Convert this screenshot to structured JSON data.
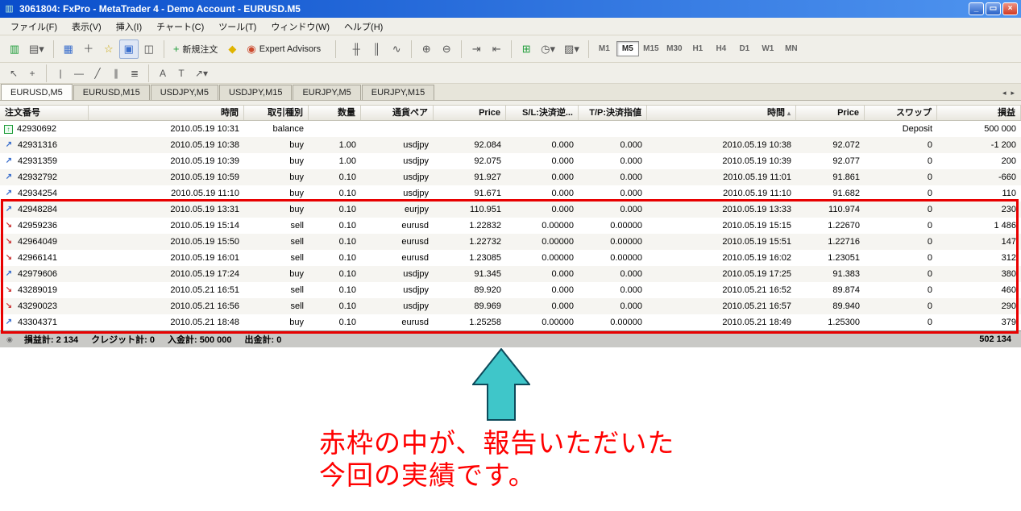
{
  "window": {
    "title": "3061804: FxPro - MetaTrader 4 - Demo Account - EURUSD.M5",
    "icon_glyph": "▥",
    "controls": {
      "minimize": "_",
      "restore": "▭",
      "close": "×"
    }
  },
  "menu": {
    "items": [
      "ファイル(F)",
      "表示(V)",
      "挿入(I)",
      "チャート(C)",
      "ツール(T)",
      "ウィンドウ(W)",
      "ヘルプ(H)"
    ]
  },
  "toolbar_main": {
    "buttons": [
      {
        "name": "new-chart-button",
        "glyph": "▥",
        "color": "#1f9d3a"
      },
      {
        "name": "profiles-button",
        "glyph": "▤▾"
      },
      {
        "separator": true
      },
      {
        "name": "market-watch-button",
        "glyph": "▦",
        "color": "#3a6ecc"
      },
      {
        "name": "data-window-button",
        "glyph": "＋"
      },
      {
        "name": "navigator-button",
        "glyph": "☆",
        "color": "#c8a400"
      },
      {
        "name": "terminal-button",
        "glyph": "▣",
        "color": "#3a6ecc",
        "pressed": true
      },
      {
        "name": "strategy-tester-button",
        "glyph": "◫"
      },
      {
        "separator": true
      },
      {
        "name": "new-order-button",
        "glyph": "+",
        "color": "#1f9d3a",
        "label": "新規注文"
      },
      {
        "name": "metaeditor-button",
        "glyph": "◆",
        "color": "#e0b400"
      },
      {
        "name": "expert-advisors-button",
        "glyph": "◉",
        "color": "#cc4a2e",
        "label": "Expert Advisors"
      },
      {
        "separator": true,
        "wide": true
      },
      {
        "name": "bar-chart-button",
        "glyph": "╫"
      },
      {
        "name": "candlestick-chart-button",
        "glyph": "║"
      },
      {
        "name": "line-chart-button",
        "glyph": "∿"
      },
      {
        "separator": true
      },
      {
        "name": "zoom-in-button",
        "glyph": "⊕"
      },
      {
        "name": "zoom-out-button",
        "glyph": "⊖"
      },
      {
        "separator": true
      },
      {
        "name": "auto-scroll-button",
        "glyph": "⇥"
      },
      {
        "name": "chart-shift-button",
        "glyph": "⇤"
      },
      {
        "separator": true
      },
      {
        "name": "indicators-button",
        "glyph": "⊞",
        "color": "#1f9d3a"
      },
      {
        "name": "periods-button",
        "glyph": "◷▾"
      },
      {
        "name": "templates-button",
        "glyph": "▨▾"
      },
      {
        "separator": true
      }
    ]
  },
  "timeframes": {
    "items": [
      "M1",
      "M5",
      "M15",
      "M30",
      "H1",
      "H4",
      "D1",
      "W1",
      "MN"
    ],
    "active": "M5"
  },
  "toolbar_drawing": {
    "buttons": [
      {
        "name": "cursor-button",
        "glyph": "↖"
      },
      {
        "name": "crosshair-button",
        "glyph": "+"
      },
      {
        "separator": true
      },
      {
        "name": "vertical-line-button",
        "glyph": "|"
      },
      {
        "name": "horizontal-line-button",
        "glyph": "—"
      },
      {
        "name": "trendline-button",
        "glyph": "╱"
      },
      {
        "name": "equidistant-channel-button",
        "glyph": "∥"
      },
      {
        "name": "fibonacci-button",
        "glyph": "≣"
      },
      {
        "separator": true
      },
      {
        "name": "text-button",
        "glyph": "A"
      },
      {
        "name": "text-label-button",
        "glyph": "T"
      },
      {
        "name": "arrow-tools-button",
        "glyph": "↗▾"
      }
    ]
  },
  "tabs": {
    "items": [
      "EURUSD,M5",
      "EURUSD,M15",
      "USDJPY,M5",
      "USDJPY,M15",
      "EURJPY,M5",
      "EURJPY,M15"
    ],
    "active_index": 0,
    "scroll_left": "◂",
    "scroll_right": "▸"
  },
  "icon_map": {
    "deposit-icon": {
      "glyph": "↑",
      "color": "#1f9d3a",
      "boxed": true
    },
    "buy-order-icon": {
      "glyph": "↗",
      "color": "#3a6ecc"
    },
    "sell-order-icon": {
      "glyph": "↘",
      "color": "#cc3a3a"
    }
  },
  "history": {
    "columns": [
      "注文番号",
      "時間",
      "取引種別",
      "数量",
      "通貨ペア",
      "Price",
      "S/L:決済逆...",
      "T/P:決済指値",
      "時間",
      "Price",
      "スワップ",
      "損益"
    ],
    "sorted_column_index": 8,
    "sort_glyph": "▴",
    "rows": [
      {
        "icon": "deposit-icon",
        "cells": [
          "42930692",
          "2010.05.19 10:31",
          "balance",
          "",
          "",
          "",
          "",
          "",
          "",
          "",
          "Deposit",
          "500 000"
        ]
      },
      {
        "icon": "buy-order-icon",
        "cells": [
          "42931316",
          "2010.05.19 10:38",
          "buy",
          "1.00",
          "usdjpy",
          "92.084",
          "0.000",
          "0.000",
          "2010.05.19 10:38",
          "92.072",
          "0",
          "-1 200"
        ]
      },
      {
        "icon": "buy-order-icon",
        "cells": [
          "42931359",
          "2010.05.19 10:39",
          "buy",
          "1.00",
          "usdjpy",
          "92.075",
          "0.000",
          "0.000",
          "2010.05.19 10:39",
          "92.077",
          "0",
          "200"
        ]
      },
      {
        "icon": "buy-order-icon",
        "cells": [
          "42932792",
          "2010.05.19 10:59",
          "buy",
          "0.10",
          "usdjpy",
          "91.927",
          "0.000",
          "0.000",
          "2010.05.19 11:01",
          "91.861",
          "0",
          "-660"
        ]
      },
      {
        "icon": "buy-order-icon",
        "cells": [
          "42934254",
          "2010.05.19 11:10",
          "buy",
          "0.10",
          "usdjpy",
          "91.671",
          "0.000",
          "0.000",
          "2010.05.19 11:10",
          "91.682",
          "0",
          "110"
        ]
      },
      {
        "icon": "buy-order-icon",
        "cells": [
          "42948284",
          "2010.05.19 13:31",
          "buy",
          "0.10",
          "eurjpy",
          "110.951",
          "0.000",
          "0.000",
          "2010.05.19 13:33",
          "110.974",
          "0",
          "230"
        ]
      },
      {
        "icon": "sell-order-icon",
        "cells": [
          "42959236",
          "2010.05.19 15:14",
          "sell",
          "0.10",
          "eurusd",
          "1.22832",
          "0.00000",
          "0.00000",
          "2010.05.19 15:15",
          "1.22670",
          "0",
          "1 486"
        ]
      },
      {
        "icon": "sell-order-icon",
        "cells": [
          "42964049",
          "2010.05.19 15:50",
          "sell",
          "0.10",
          "eurusd",
          "1.22732",
          "0.00000",
          "0.00000",
          "2010.05.19 15:51",
          "1.22716",
          "0",
          "147"
        ]
      },
      {
        "icon": "sell-order-icon",
        "cells": [
          "42966141",
          "2010.05.19 16:01",
          "sell",
          "0.10",
          "eurusd",
          "1.23085",
          "0.00000",
          "0.00000",
          "2010.05.19 16:02",
          "1.23051",
          "0",
          "312"
        ]
      },
      {
        "icon": "buy-order-icon",
        "cells": [
          "42979606",
          "2010.05.19 17:24",
          "buy",
          "0.10",
          "usdjpy",
          "91.345",
          "0.000",
          "0.000",
          "2010.05.19 17:25",
          "91.383",
          "0",
          "380"
        ]
      },
      {
        "icon": "sell-order-icon",
        "cells": [
          "43289019",
          "2010.05.21 16:51",
          "sell",
          "0.10",
          "usdjpy",
          "89.920",
          "0.000",
          "0.000",
          "2010.05.21 16:52",
          "89.874",
          "0",
          "460"
        ]
      },
      {
        "icon": "sell-order-icon",
        "cells": [
          "43290023",
          "2010.05.21 16:56",
          "sell",
          "0.10",
          "usdjpy",
          "89.969",
          "0.000",
          "0.000",
          "2010.05.21 16:57",
          "89.940",
          "0",
          "290"
        ]
      },
      {
        "icon": "buy-order-icon",
        "cells": [
          "43304371",
          "2010.05.21 18:48",
          "buy",
          "0.10",
          "eurusd",
          "1.25258",
          "0.00000",
          "0.00000",
          "2010.05.21 18:49",
          "1.25300",
          "0",
          "379"
        ]
      }
    ]
  },
  "highlight": {
    "color": "#e80000",
    "start_row_index": 5,
    "end_row_index": 12
  },
  "summary": {
    "status_glyph": "◉",
    "items": [
      {
        "label": "損益計:",
        "value": "2 134"
      },
      {
        "label": "クレジット計:",
        "value": "0"
      },
      {
        "label": "入金計:",
        "value": "500 000"
      },
      {
        "label": "出金計:",
        "value": "0"
      }
    ],
    "balance": "502 134"
  },
  "annotation": {
    "lines": [
      "赤枠の中が、報告いただいた",
      "今回の実績です。"
    ],
    "color": "#ff0000",
    "arrow_fill": "#3fc6c9",
    "arrow_stroke": "#0d4a5a"
  }
}
